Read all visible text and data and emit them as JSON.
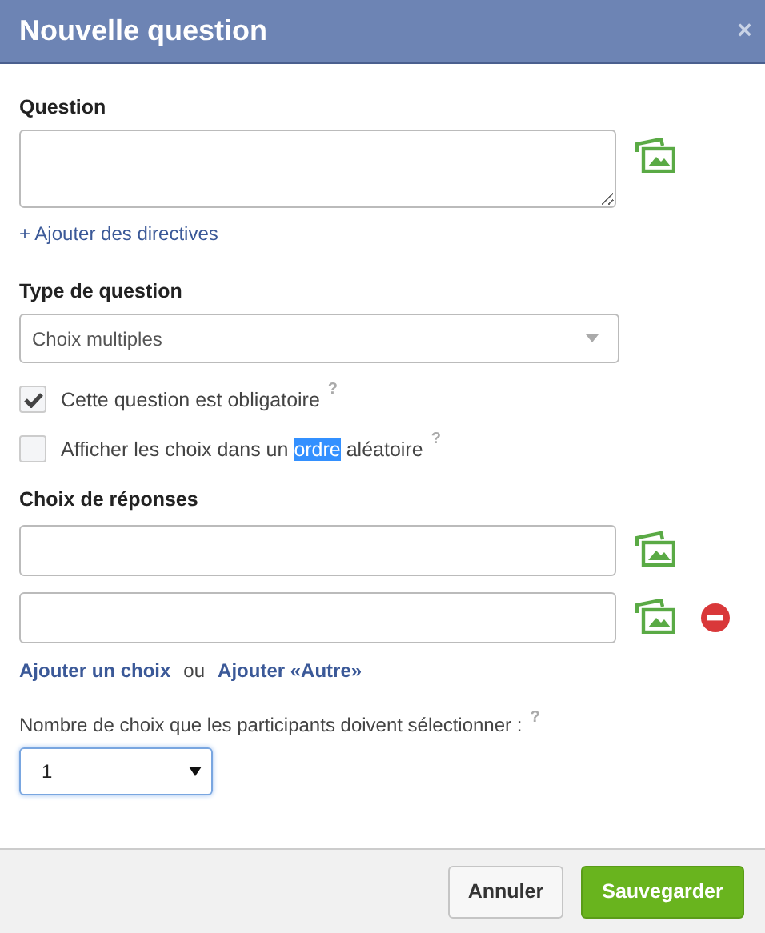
{
  "dialog": {
    "title": "Nouvelle question",
    "close": "×"
  },
  "question": {
    "label": "Question",
    "add_instructions": "+ Ajouter des directives"
  },
  "question_type": {
    "label": "Type de question",
    "value": "Choix multiples"
  },
  "options": [
    {
      "parts": [
        {
          "text": "Cette question est obligatoire",
          "selected": false
        }
      ],
      "checked": true,
      "help": "?"
    },
    {
      "parts": [
        {
          "text": "Afficher les choix dans un ",
          "selected": false
        },
        {
          "text": "ordre",
          "selected": true
        },
        {
          "text": " aléatoire",
          "selected": false
        }
      ],
      "checked": false,
      "help": "?"
    }
  ],
  "answers": {
    "label": "Choix de réponses",
    "choices": [
      {
        "removable": false
      },
      {
        "removable": true
      }
    ],
    "add_choice": "Ajouter un choix",
    "separator": "ou",
    "add_other": "Ajouter «Autre»"
  },
  "selection_count": {
    "label": "Nombre de choix que les participants doivent sélectionner :",
    "help": "?",
    "value": "1"
  },
  "buttons": [
    {
      "label": "Annuler",
      "kind": "secondary"
    },
    {
      "label": "Sauvegarder",
      "kind": "primary"
    }
  ]
}
